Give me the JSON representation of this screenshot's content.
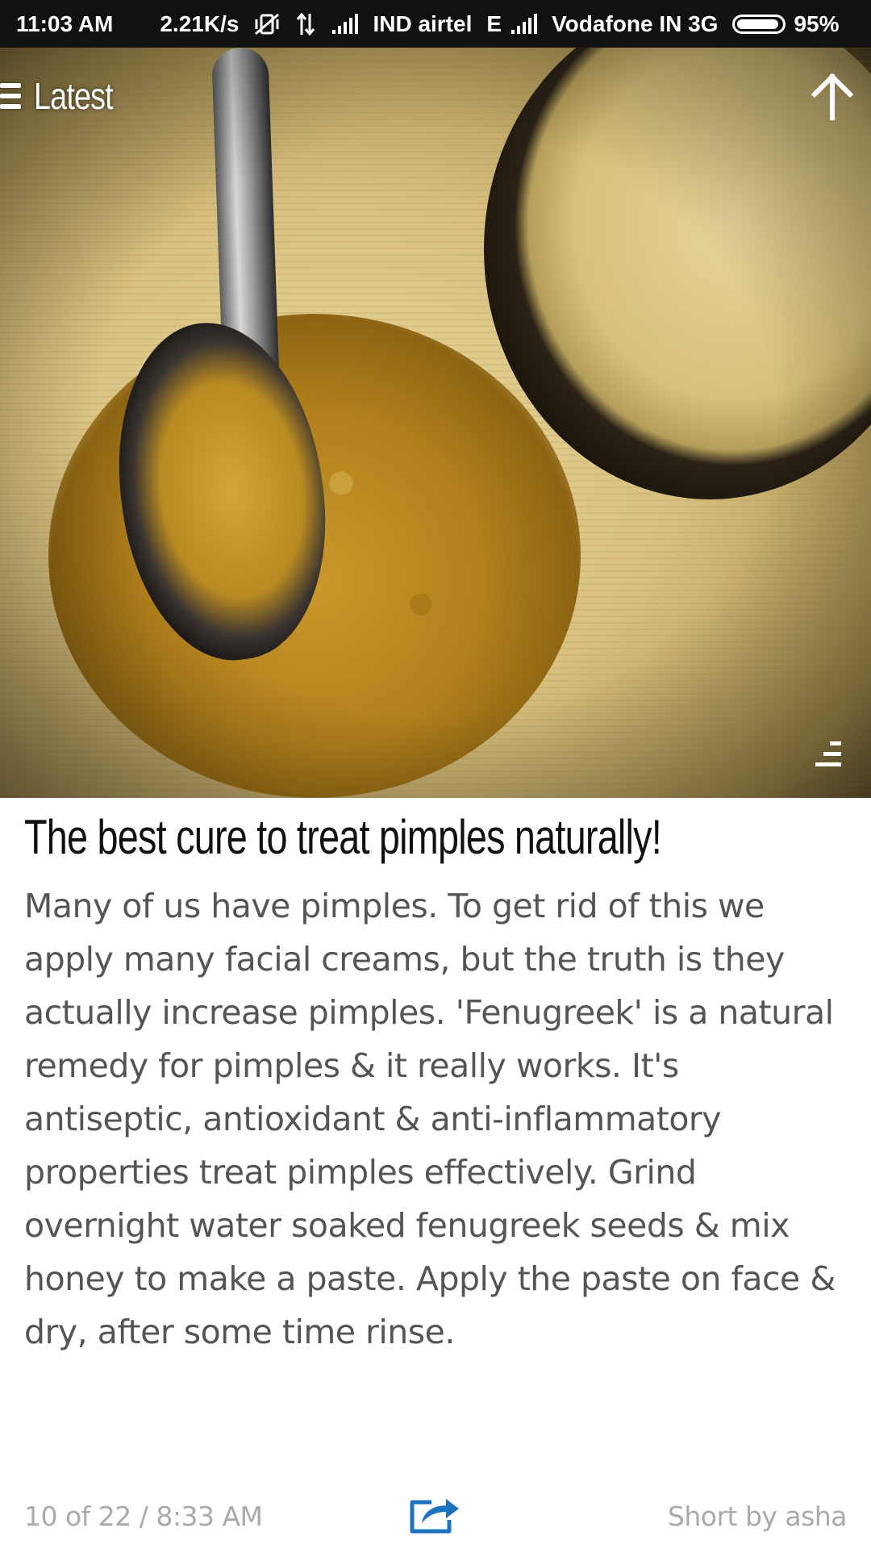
{
  "status_bar": {
    "time": "11:03 AM",
    "speed": "2.21K/s",
    "carrier1": "IND airtel",
    "network1": "E",
    "carrier2": "Vodafone IN 3G",
    "battery": "95%"
  },
  "header": {
    "section_label": "Latest"
  },
  "article": {
    "headline": "The best cure to treat pimples naturally!",
    "body": "Many of us have pimples. To get rid of this we apply many facial creams, but the truth is they actually increase pimples. 'Fenugreek' is a natural remedy for pimples & it really works. It's antiseptic, antioxidant & anti-inflammatory properties treat pimples effectively. Grind overnight water soaked fenugreek seeds & mix honey to make a paste. Apply the paste on face & dry, after some time rinse."
  },
  "footer": {
    "position": "10  of  22 / 8:33 AM",
    "author": "Short by asha"
  },
  "colors": {
    "status_bg": "#111111",
    "headline": "#111111",
    "body": "#555555",
    "meta": "#aaaaaa",
    "share_icon": "#1e73be"
  },
  "icons": {
    "menu": "hamburger-menu-icon",
    "scroll_top": "arrow-up-icon",
    "image_menu": "image-options-icon",
    "share": "share-icon",
    "mute": "vibrate-mute-icon",
    "data": "data-transfer-icon",
    "signal": "signal-bars-icon"
  }
}
